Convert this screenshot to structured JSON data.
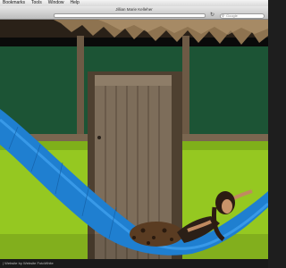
{
  "menubar": {
    "items": [
      "Bookmarks",
      "Tools",
      "Window",
      "Help"
    ]
  },
  "window": {
    "title": "Jillian Marie Kelleher"
  },
  "search": {
    "placeholder": "Google"
  },
  "footer": {
    "left": "| Website by",
    "credit": "Website FotoWhite"
  },
  "colors": {
    "wall_green": "#95c821",
    "hammock_blue": "#1f7fd0",
    "door_wood": "#7d6d5a"
  }
}
